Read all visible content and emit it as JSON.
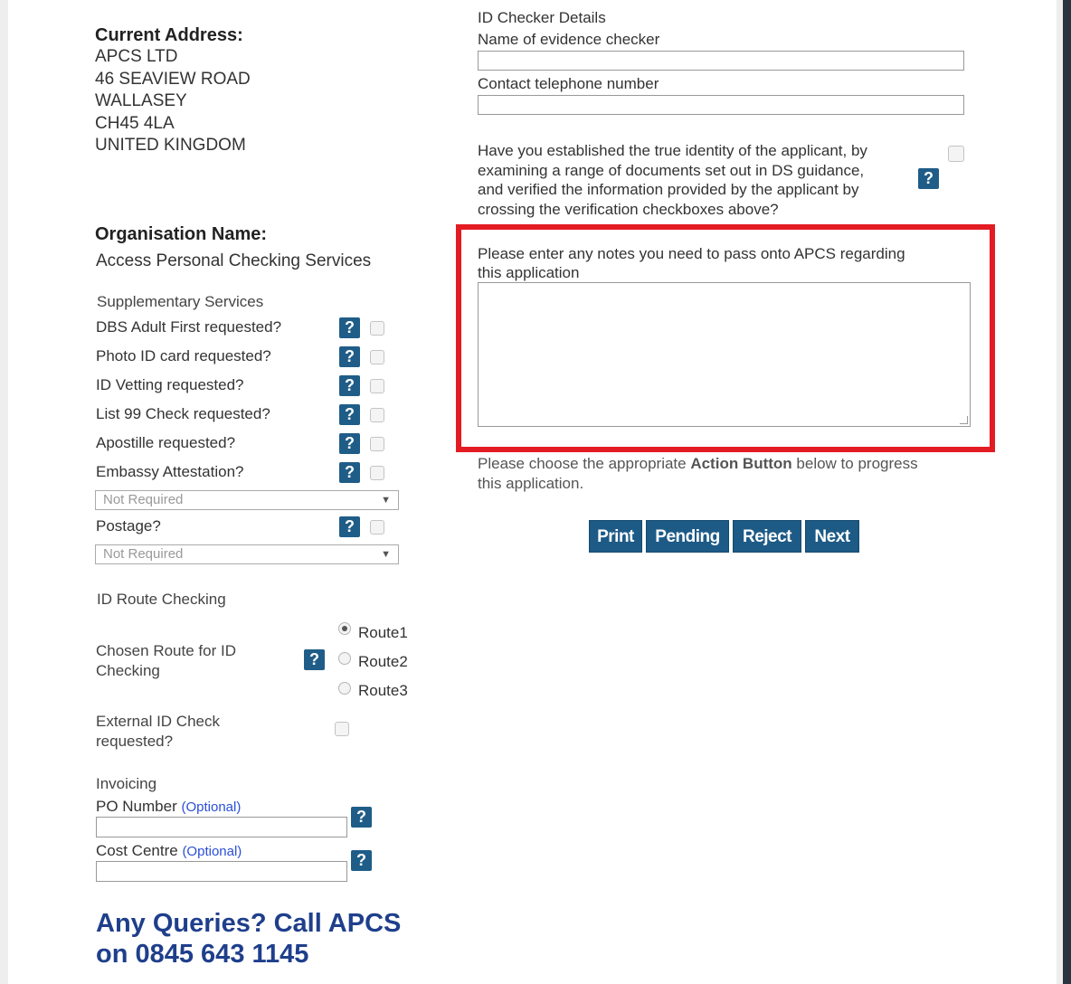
{
  "address": {
    "title": "Current Address:",
    "lines": [
      "APCS LTD",
      "46 SEAVIEW ROAD",
      "WALLASEY",
      "CH45 4LA",
      "UNITED KINGDOM"
    ]
  },
  "organisation": {
    "title": "Organisation Name:",
    "value": "Access Personal Checking Services"
  },
  "supplementary": {
    "heading": "Supplementary Services",
    "items": [
      "DBS Adult First requested?",
      "Photo ID card requested?",
      "ID Vetting requested?",
      "List 99 Check requested?",
      "Apostille requested?",
      "Embassy Attestation?"
    ],
    "embassy_select": "Not Required",
    "postage_label": "Postage?",
    "postage_select": "Not Required"
  },
  "route": {
    "heading": "ID Route Checking",
    "chosen_label": "Chosen Route for ID Checking",
    "options": [
      "Route1",
      "Route2",
      "Route3"
    ],
    "selected": "Route1",
    "external_label": "External ID Check requested?"
  },
  "invoicing": {
    "heading": "Invoicing",
    "po_label": "PO Number",
    "cost_label": "Cost Centre",
    "optional": "(Optional)"
  },
  "queries": {
    "line1": "Any Queries? Call APCS",
    "line2": "on 0845 643 1145"
  },
  "checker": {
    "heading": "ID Checker Details",
    "name_label": "Name of evidence checker",
    "phone_label": "Contact telephone number",
    "identity_question_lines": [
      "Have you established the true identity of the applicant, by",
      "examining a range of documents set out in DS guidance,",
      "and verified the information provided by the applicant by",
      "crossing the verification checkboxes above?"
    ]
  },
  "notes": {
    "label_line1": "Please enter any notes you need to pass onto APCS regarding",
    "label_line2": "this application"
  },
  "action": {
    "text_pre": "Please choose the appropriate ",
    "text_bold": "Action Button",
    "text_post": " below to progress",
    "text_line2": "this application.",
    "buttons": [
      "Print",
      "Pending",
      "Reject",
      "Next"
    ]
  },
  "help_glyph": "?",
  "colors": {
    "help_button": "#1f5d88",
    "action_button": "#1d5a86",
    "highlight": "#e31b23",
    "queries_text": "#1f3f8c"
  }
}
